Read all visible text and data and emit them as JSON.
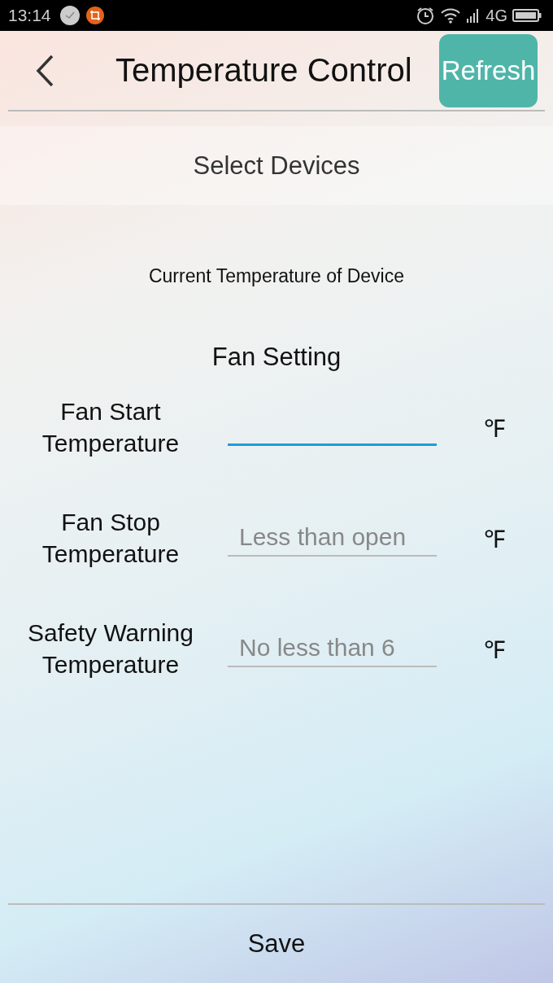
{
  "status_bar": {
    "time": "13:14",
    "network": "4G"
  },
  "header": {
    "title": "Temperature Control",
    "refresh_label": "Refresh"
  },
  "device_selector": {
    "label": "Select Devices"
  },
  "current_temperature": {
    "label": "Current Temperature of Device"
  },
  "fan_setting": {
    "title": "Fan Setting",
    "fields": [
      {
        "label": "Fan Start Temperature",
        "focused": true,
        "unit": "℉"
      },
      {
        "label": "Fan Stop Temperature",
        "placeholder": "Less than open",
        "focused": false,
        "unit": "℉"
      },
      {
        "label": "Safety Warning Temperature",
        "placeholder": "No less than 6",
        "focused": false,
        "unit": "℉"
      }
    ]
  },
  "save_label": "Save"
}
